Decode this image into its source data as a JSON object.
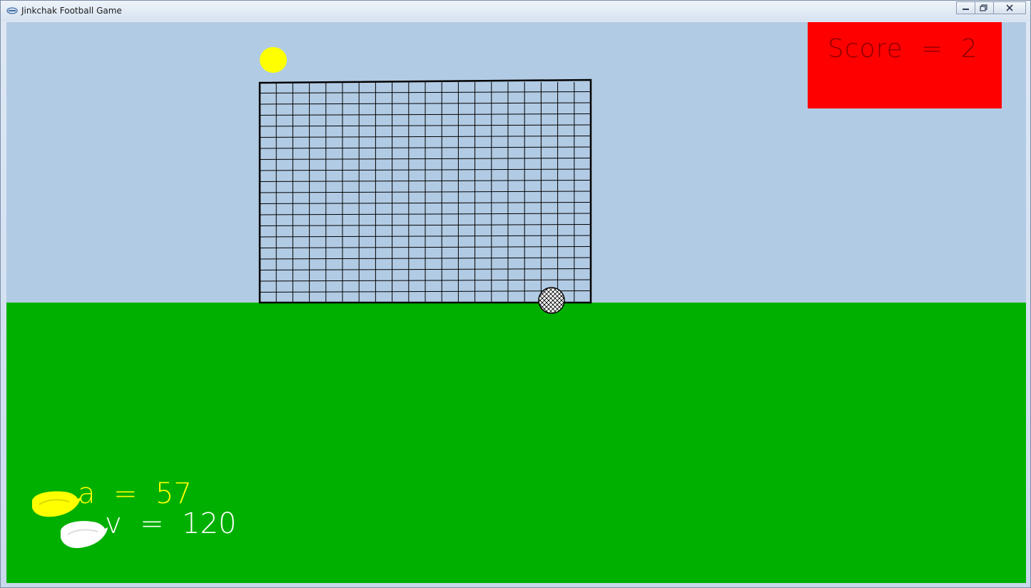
{
  "window": {
    "title": "Jinkchak Football Game"
  },
  "score": {
    "label": "Score  =  2",
    "value": 2
  },
  "hud": {
    "angle_label": "a  =  57",
    "angle_value": 57,
    "velocity_label": "v  =  120",
    "velocity_value": 120
  },
  "colors": {
    "sky": "#b2cbe4",
    "ground": "#00b000",
    "score_box": "#ff0000",
    "angle_hud": "#ffff00",
    "velocity_hud": "#ffffff",
    "target": "#ffff00"
  },
  "icons": {
    "app": "app-icon",
    "minimize": "minimize-icon",
    "maximize": "maximize-icon",
    "close": "close-icon"
  }
}
